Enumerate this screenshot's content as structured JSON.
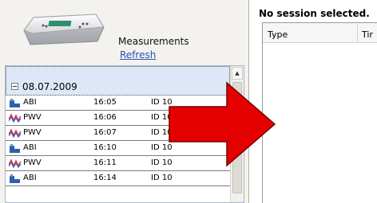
{
  "device_panel": {
    "label": "Measurements",
    "refresh_label": "Refresh"
  },
  "session_list": {
    "group_date": "08.07.2009",
    "rows": [
      {
        "type": "ABI",
        "time": "16:05",
        "id": "ID 10",
        "icon": "abi-icon"
      },
      {
        "type": "PWV",
        "time": "16:06",
        "id": "ID 10",
        "icon": "pwv-icon"
      },
      {
        "type": "PWV",
        "time": "16:07",
        "id": "ID 10",
        "icon": "pwv-icon"
      },
      {
        "type": "ABI",
        "time": "16:10",
        "id": "ID 10",
        "icon": "abi-icon"
      },
      {
        "type": "PWV",
        "time": "16:11",
        "id": "ID 10",
        "icon": "pwv-icon"
      },
      {
        "type": "ABI",
        "time": "16:14",
        "id": "ID 10",
        "icon": "abi-icon"
      }
    ]
  },
  "details_panel": {
    "status": "No session selected.",
    "columns": [
      "Type",
      "Tir"
    ]
  },
  "colors": {
    "arrow": "#e50000",
    "selection": "#dde7f7",
    "link": "#2a51b8"
  }
}
